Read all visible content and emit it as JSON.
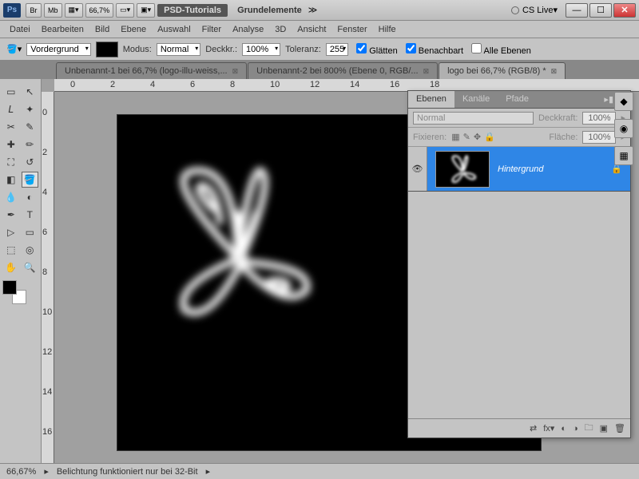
{
  "titlebar": {
    "zoom": "66,7%",
    "pill": "PSD-Tutorials",
    "doc": "Grundelemente",
    "cslive": "CS Live"
  },
  "menu": [
    "Datei",
    "Bearbeiten",
    "Bild",
    "Ebene",
    "Auswahl",
    "Filter",
    "Analyse",
    "3D",
    "Ansicht",
    "Fenster",
    "Hilfe"
  ],
  "options": {
    "vg_label": "Vordergrund",
    "modus_label": "Modus:",
    "modus_value": "Normal",
    "deckkr_label": "Deckkr.:",
    "deckkr_value": "100%",
    "toleranz_label": "Toleranz:",
    "toleranz_value": "255",
    "glaetten": "Glätten",
    "benachbart": "Benachbart",
    "alle_ebenen": "Alle Ebenen"
  },
  "tabs": [
    {
      "label": "Unbenannt-1 bei 66,7% (logo-illu-weiss,...",
      "active": false
    },
    {
      "label": "Unbenannt-2 bei 800% (Ebene 0, RGB/...",
      "active": false
    },
    {
      "label": "logo bei 66,7% (RGB/8) *",
      "active": true
    }
  ],
  "ruler_h": [
    "0",
    "2",
    "4",
    "6",
    "8",
    "10",
    "12",
    "14",
    "16",
    "18"
  ],
  "ruler_v": [
    "0",
    "2",
    "4",
    "6",
    "8",
    "10",
    "12",
    "14",
    "16"
  ],
  "panel": {
    "tabs": [
      "Ebenen",
      "Kanäle",
      "Pfade"
    ],
    "blend": "Normal",
    "deckkraft_label": "Deckkraft:",
    "deckkraft_value": "100%",
    "fixieren_label": "Fixieren:",
    "flaeche_label": "Fläche:",
    "flaeche_value": "100%",
    "layer_name": "Hintergrund"
  },
  "status": {
    "zoom": "66,67%",
    "msg": "Belichtung funktioniert nur bei 32-Bit"
  }
}
